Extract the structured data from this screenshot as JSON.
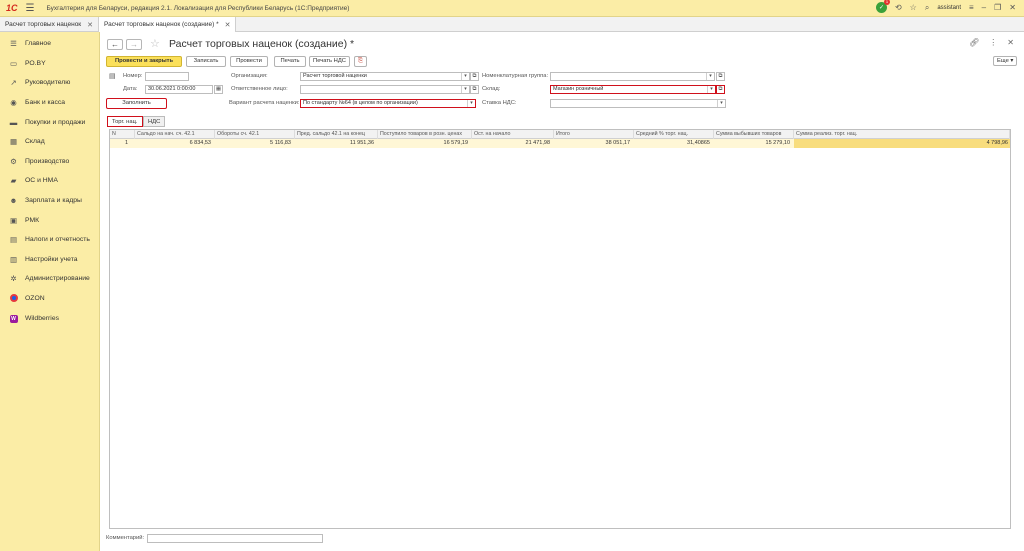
{
  "app": {
    "title": "Бухгалтерия для Беларуси, редакция 2.1. Локализация для Республики Беларусь   (1С:Предприятие)",
    "logo": "1С",
    "user": "assistant",
    "notification_count": "1"
  },
  "doc_tabs": [
    {
      "label": "Расчет торговых наценок"
    },
    {
      "label": "Расчет торговых наценок (создание) *"
    }
  ],
  "sidebar": {
    "items": [
      {
        "label": "Главное",
        "icon": "menu-icon"
      },
      {
        "label": "РО.BY",
        "icon": "tag-icon"
      },
      {
        "label": "Руководителю",
        "icon": "trend-icon"
      },
      {
        "label": "Банк и касса",
        "icon": "bank-icon"
      },
      {
        "label": "Покупки и продажи",
        "icon": "cart-icon"
      },
      {
        "label": "Склад",
        "icon": "warehouse-icon"
      },
      {
        "label": "Производство",
        "icon": "factory-icon"
      },
      {
        "label": "ОС и НМА",
        "icon": "truck-icon"
      },
      {
        "label": "Зарплата и кадры",
        "icon": "people-icon"
      },
      {
        "label": "РМК",
        "icon": "register-icon"
      },
      {
        "label": "Налоги и отчетность",
        "icon": "report-icon"
      },
      {
        "label": "Настройки учета",
        "icon": "settings-icon"
      },
      {
        "label": "Администрирование",
        "icon": "gear-icon"
      },
      {
        "label": "OZON",
        "icon": "ozon-icon"
      },
      {
        "label": "Wildberries",
        "icon": "wb-icon"
      }
    ]
  },
  "doc": {
    "title": "Расчет торговых наценок (создание) *"
  },
  "toolbar": {
    "post_close": "Провести и закрыть",
    "save": "Записать",
    "post": "Провести",
    "print": "Печать",
    "print_vat": "Печать НДС",
    "more": "Еще"
  },
  "form": {
    "number_label": "Номер:",
    "number_value": "",
    "date_label": "Дата:",
    "date_value": "30.06.2021  0:00:00",
    "org_label": "Организация:",
    "org_value": "Расчет торговой наценки",
    "resp_label": "Ответственное лицо:",
    "resp_value": "",
    "variant_label": "Вариант расчета наценки:",
    "variant_value": "По стандарту №64 (в целом по организации)",
    "nomgroup_label": "Номенклатурная группа:",
    "nomgroup_value": "",
    "warehouse_label": "Склад:",
    "warehouse_value": "Магазин розничный",
    "vat_label": "Ставка НДС:",
    "vat_value": "",
    "fill_button": "Заполнить"
  },
  "tabs": [
    {
      "label": "Торг. нац."
    },
    {
      "label": "НДС"
    }
  ],
  "table": {
    "headers": [
      "N",
      "Сальдо на нач. сч. 42.1",
      "Обороты сч. 42.1",
      "Пред. сальдо 42.1 на конец",
      "Поступило товаров в розн. ценах",
      "Ост. на начало",
      "Итого",
      "Средний % торг. нац.",
      "Сумма выбывших товаров",
      "Сумма реализ. торг. нац."
    ],
    "rows": [
      [
        "1",
        "6 834,53",
        "5 116,83",
        "11 951,36",
        "16 579,19",
        "21 471,98",
        "38 051,17",
        "31,40865",
        "15 279,10",
        "4 798,96"
      ]
    ]
  },
  "comment": {
    "label": "Комментарий:",
    "value": ""
  }
}
